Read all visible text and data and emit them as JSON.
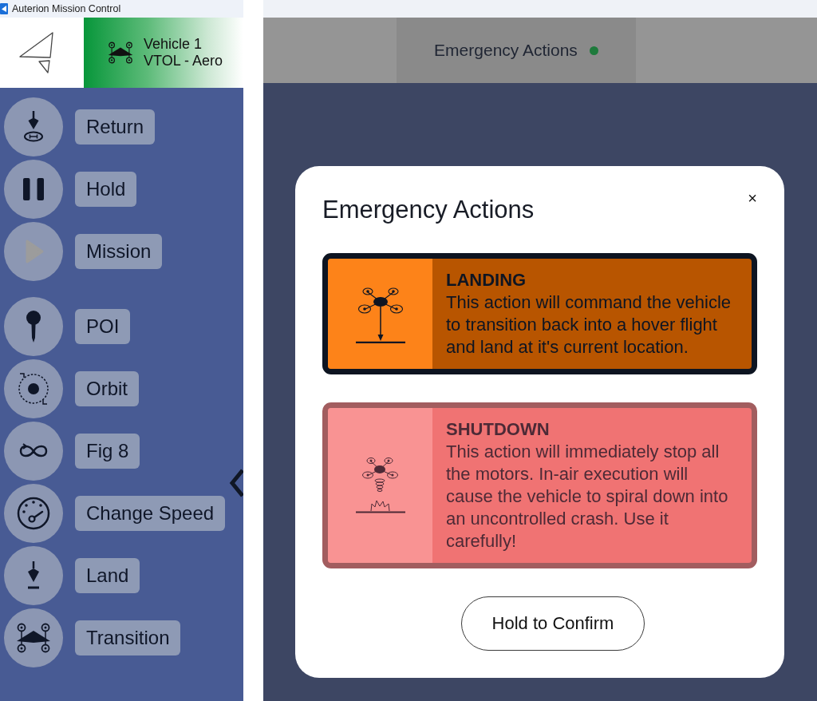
{
  "window": {
    "title": "Auterion Mission Control"
  },
  "vehicle": {
    "name": "Vehicle 1",
    "type": "VTOL - Aero"
  },
  "sidebar": {
    "groups": [
      [
        {
          "kind": "return",
          "label": "Return",
          "disabled": false
        },
        {
          "kind": "hold",
          "label": "Hold",
          "disabled": false
        },
        {
          "kind": "mission",
          "label": "Mission",
          "disabled": true
        }
      ],
      [
        {
          "kind": "poi",
          "label": "POI",
          "disabled": false
        },
        {
          "kind": "orbit",
          "label": "Orbit",
          "disabled": false
        },
        {
          "kind": "figure8",
          "label": "Fig 8",
          "disabled": false
        },
        {
          "kind": "speed",
          "label": "Change Speed",
          "disabled": false
        },
        {
          "kind": "land",
          "label": "Land",
          "disabled": false
        },
        {
          "kind": "transition",
          "label": "Transition",
          "disabled": false
        }
      ]
    ]
  },
  "header": {
    "tabs": [
      {
        "label": "Emergency Actions",
        "selected": true
      }
    ]
  },
  "dialog": {
    "title": "Emergency Actions",
    "close": "×",
    "actions": [
      {
        "kind": "landing",
        "title": "LANDING",
        "description": "This action will command the vehicle to transition back into a hover flight and land at it's current location.",
        "selected": true
      },
      {
        "kind": "shutdown",
        "title": "SHUTDOWN",
        "description": "This action will immediately stop all the motors. In-air execution will cause the vehicle to spiral down into an uncontrolled crash. Use it carefully!",
        "selected": false
      }
    ],
    "confirm_button": "Hold to Confirm"
  }
}
